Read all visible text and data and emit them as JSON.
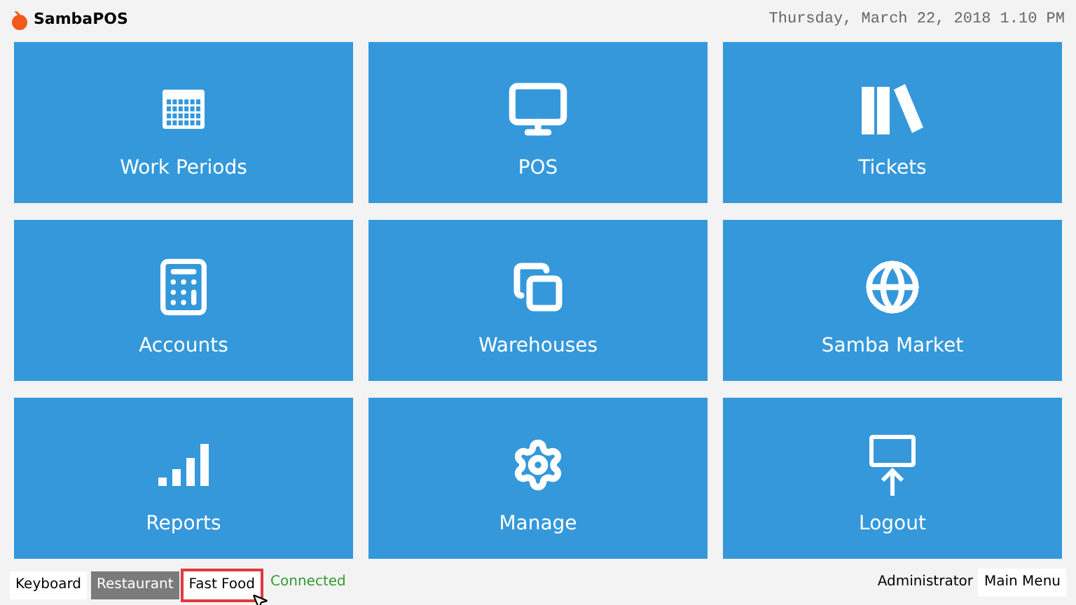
{
  "app": {
    "name": "SambaPOS",
    "datetime": "Thursday, March 22, 2018 1.10 PM"
  },
  "tiles": [
    {
      "label": "Work Periods"
    },
    {
      "label": "POS"
    },
    {
      "label": "Tickets"
    },
    {
      "label": "Accounts"
    },
    {
      "label": "Warehouses"
    },
    {
      "label": "Samba Market"
    },
    {
      "label": "Reports"
    },
    {
      "label": "Manage"
    },
    {
      "label": "Logout"
    }
  ],
  "status_bar": {
    "buttons": [
      {
        "label": "Keyboard",
        "selected": false,
        "highlighted": false
      },
      {
        "label": "Restaurant",
        "selected": true,
        "highlighted": false
      },
      {
        "label": "Fast Food",
        "selected": false,
        "highlighted": true
      }
    ],
    "connection": "Connected",
    "user": "Administrator",
    "menu_button": "Main Menu"
  }
}
